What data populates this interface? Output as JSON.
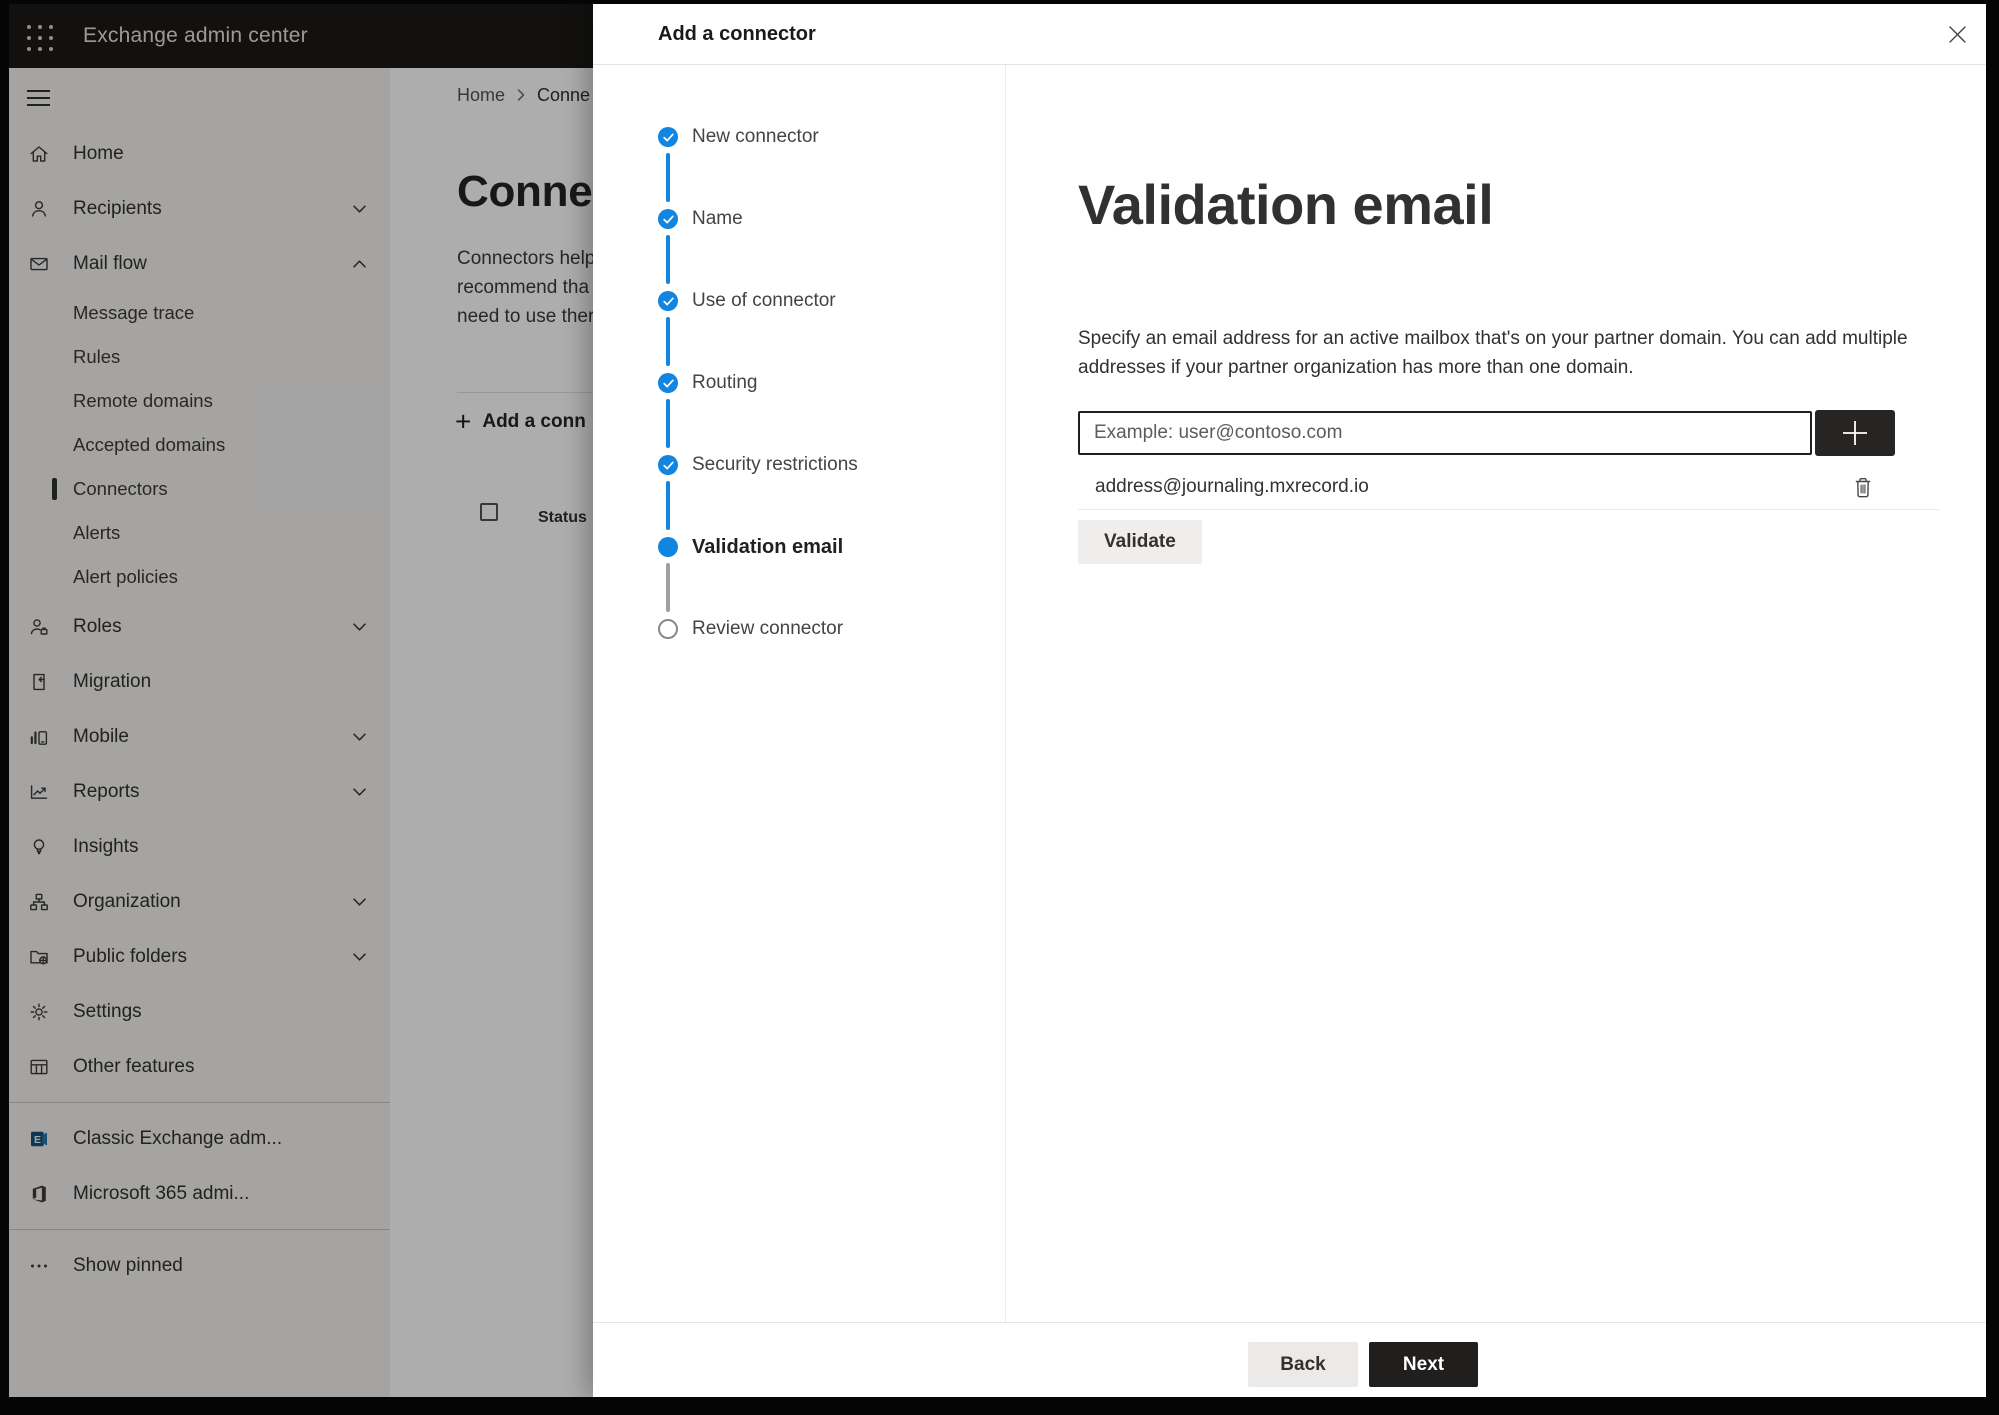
{
  "colors": {
    "accent_blue": "#1285e0",
    "topbar_bg": "#1b1a19",
    "sidebar_bg": "#f3f2f1",
    "primary_button_bg": "#201f1e",
    "overlay": "rgba(0,0,0,0.32)"
  },
  "topbar": {
    "title": "Exchange admin center",
    "waffle_icon": "app-launcher-icon"
  },
  "sidebar": {
    "hamburger_icon": "menu-icon",
    "items": [
      {
        "label": "Home",
        "icon": "home-icon"
      },
      {
        "label": "Recipients",
        "icon": "recipients-icon",
        "chevron": "down"
      },
      {
        "label": "Mail flow",
        "icon": "mail-flow-icon",
        "chevron": "up",
        "expanded": true
      },
      {
        "label": "Message trace",
        "sub": true
      },
      {
        "label": "Rules",
        "sub": true
      },
      {
        "label": "Remote domains",
        "sub": true
      },
      {
        "label": "Accepted domains",
        "sub": true
      },
      {
        "label": "Connectors",
        "sub": true,
        "selected": true
      },
      {
        "label": "Alerts",
        "sub": true
      },
      {
        "label": "Alert policies",
        "sub": true
      },
      {
        "label": "Roles",
        "icon": "roles-icon",
        "chevron": "down"
      },
      {
        "label": "Migration",
        "icon": "migration-icon"
      },
      {
        "label": "Mobile",
        "icon": "mobile-icon",
        "chevron": "down"
      },
      {
        "label": "Reports",
        "icon": "reports-icon",
        "chevron": "down"
      },
      {
        "label": "Insights",
        "icon": "insights-icon"
      },
      {
        "label": "Organization",
        "icon": "organization-icon",
        "chevron": "down"
      },
      {
        "label": "Public folders",
        "icon": "public-folders-icon",
        "chevron": "down"
      },
      {
        "label": "Settings",
        "icon": "settings-icon"
      },
      {
        "label": "Other features",
        "icon": "other-features-icon"
      }
    ],
    "footer_items": [
      {
        "label": "Classic Exchange adm...",
        "icon": "classic-exchange-icon"
      },
      {
        "label": "Microsoft 365 admi...",
        "icon": "microsoft-365-icon"
      }
    ],
    "show_pinned": {
      "label": "Show pinned",
      "icon": "ellipsis-icon"
    }
  },
  "page": {
    "breadcrumb": {
      "home": "Home",
      "current": "Conne"
    },
    "title": "Connec",
    "intro_lines": [
      "Connectors help",
      "recommend tha",
      "need to use ther"
    ],
    "add_button": "Add a conn",
    "table": {
      "status_header": "Status"
    }
  },
  "dialog": {
    "title": "Add a connector",
    "close_icon": "close-icon",
    "steps": [
      {
        "label": "New connector",
        "state": "completed"
      },
      {
        "label": "Name",
        "state": "completed"
      },
      {
        "label": "Use of connector",
        "state": "completed"
      },
      {
        "label": "Routing",
        "state": "completed"
      },
      {
        "label": "Security restrictions",
        "state": "completed"
      },
      {
        "label": "Validation email",
        "state": "current"
      },
      {
        "label": "Review connector",
        "state": "upcoming"
      }
    ],
    "heading": "Validation email",
    "description": "Specify an email address for an active mailbox that's on your partner domain. You can add multiple addresses if your partner organization has more than one domain.",
    "email_input": {
      "value": "",
      "placeholder": "Example: user@contoso.com"
    },
    "add_address_icon": "plus-icon",
    "addresses": [
      {
        "email": "address@journaling.mxrecord.io",
        "delete_icon": "trash-icon"
      }
    ],
    "validate_button": "Validate",
    "back_button": "Back",
    "next_button": "Next"
  }
}
